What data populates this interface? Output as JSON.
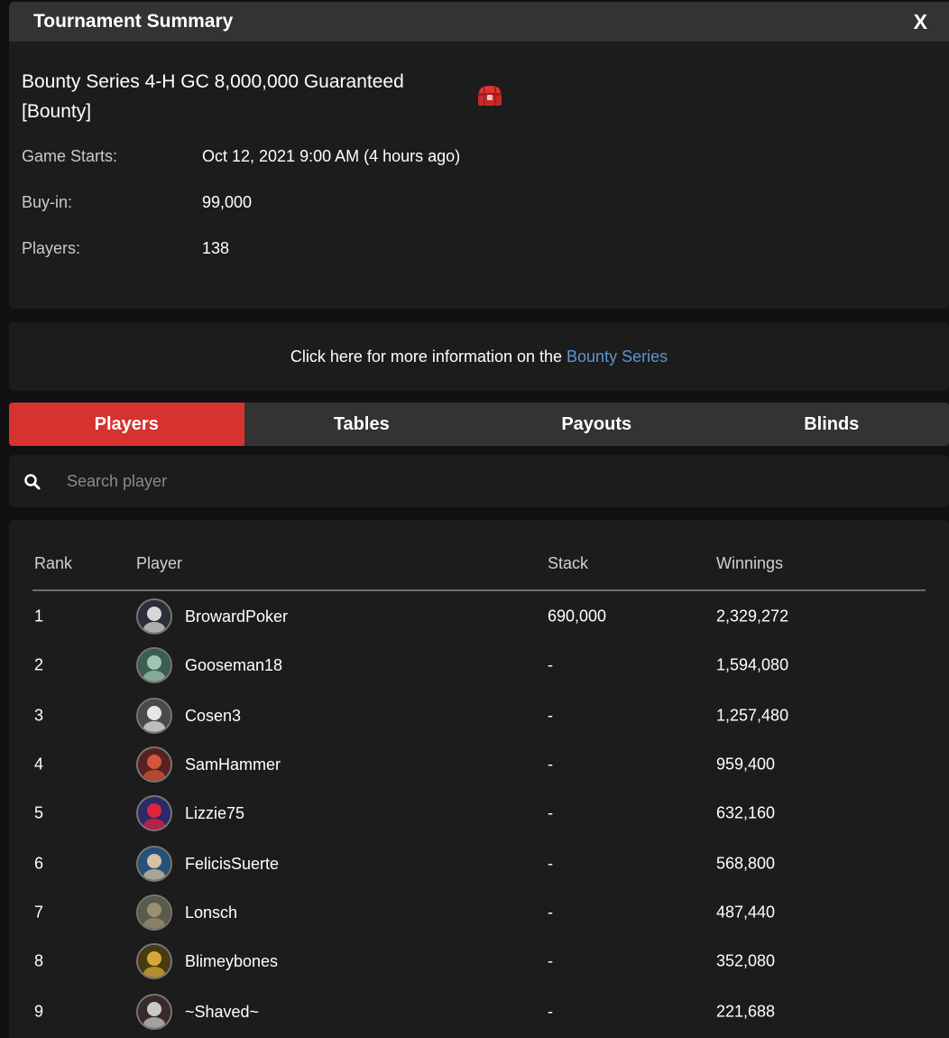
{
  "header": {
    "title": "Tournament Summary",
    "close_label": "X"
  },
  "summary": {
    "name_line1": "Bounty Series 4-H GC 8,000,000 Guaranteed",
    "name_line2": "[Bounty]",
    "bounty_icon": "treasure-chest-icon",
    "rows": [
      {
        "label": "Game Starts:",
        "value": "Oct 12, 2021 9:00 AM (4 hours ago)"
      },
      {
        "label": "Buy-in:",
        "value": "99,000"
      },
      {
        "label": "Players:",
        "value": "138"
      }
    ]
  },
  "more_info": {
    "text": "Click here for more information on the ",
    "link": "Bounty Series"
  },
  "tabs": [
    {
      "label": "Players",
      "active": true
    },
    {
      "label": "Tables",
      "active": false
    },
    {
      "label": "Payouts",
      "active": false
    },
    {
      "label": "Blinds",
      "active": false
    }
  ],
  "search": {
    "placeholder": "Search player",
    "value": "",
    "icon": "search-icon"
  },
  "table": {
    "headers": {
      "rank": "Rank",
      "player": "Player",
      "stack": "Stack",
      "winnings": "Winnings"
    },
    "rows": [
      {
        "rank": "1",
        "player": "BrowardPoker",
        "stack": "690,000",
        "winnings": "2,329,272"
      },
      {
        "rank": "2",
        "player": "Gooseman18",
        "stack": "-",
        "winnings": "1,594,080"
      },
      {
        "rank": "3",
        "player": "Cosen3",
        "stack": "-",
        "winnings": "1,257,480"
      },
      {
        "rank": "4",
        "player": "SamHammer",
        "stack": "-",
        "winnings": "959,400"
      },
      {
        "rank": "5",
        "player": "Lizzie75",
        "stack": "-",
        "winnings": "632,160"
      },
      {
        "rank": "6",
        "player": "FelicisSuerte",
        "stack": "-",
        "winnings": "568,800"
      },
      {
        "rank": "7",
        "player": "Lonsch",
        "stack": "-",
        "winnings": "487,440"
      },
      {
        "rank": "8",
        "player": "Blimeybones",
        "stack": "-",
        "winnings": "352,080"
      },
      {
        "rank": "9",
        "player": "~Shaved~",
        "stack": "-",
        "winnings": "221,688"
      }
    ]
  },
  "colors": {
    "accent_red": "#d6322f",
    "link_blue": "#5d95d2",
    "panel_bg": "#1c1c1c",
    "header_bg": "#333333"
  }
}
